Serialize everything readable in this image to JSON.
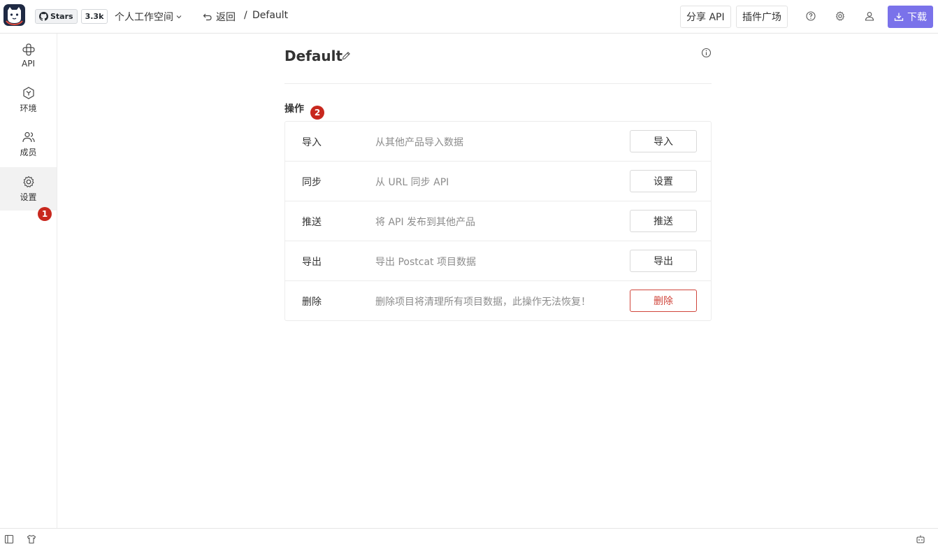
{
  "header": {
    "github": {
      "stars_label": "Stars",
      "stars_count": "3.3k"
    },
    "workspace": "个人工作空间",
    "back_label": "返回",
    "breadcrumb_sep": "/",
    "breadcrumb_current": "Default",
    "share_api": "分享 API",
    "plugins": "插件广场",
    "download": "下载",
    "accent": "#7a72ea"
  },
  "sidebar": {
    "items": [
      {
        "label": "API",
        "icon": "api-icon"
      },
      {
        "label": "环境",
        "icon": "environment-icon"
      },
      {
        "label": "成员",
        "icon": "members-icon"
      },
      {
        "label": "设置",
        "icon": "gear-icon",
        "active": true
      }
    ],
    "badge": "1"
  },
  "main": {
    "title": "Default",
    "section_title": "操作",
    "section_badge": "2",
    "operations": [
      {
        "name": "导入",
        "desc": "从其他产品导入数据",
        "button": "导入"
      },
      {
        "name": "同步",
        "desc": "从 URL 同步 API",
        "button": "设置"
      },
      {
        "name": "推送",
        "desc": "将 API 发布到其他产品",
        "button": "推送"
      },
      {
        "name": "导出",
        "desc": "导出 Postcat 项目数据",
        "button": "导出"
      },
      {
        "name": "删除",
        "desc": "删除项目将清理所有项目数据，此操作无法恢复！",
        "button": "删除",
        "danger": true
      }
    ],
    "danger_color": "#d0453b",
    "badge_color": "#c8281e"
  }
}
